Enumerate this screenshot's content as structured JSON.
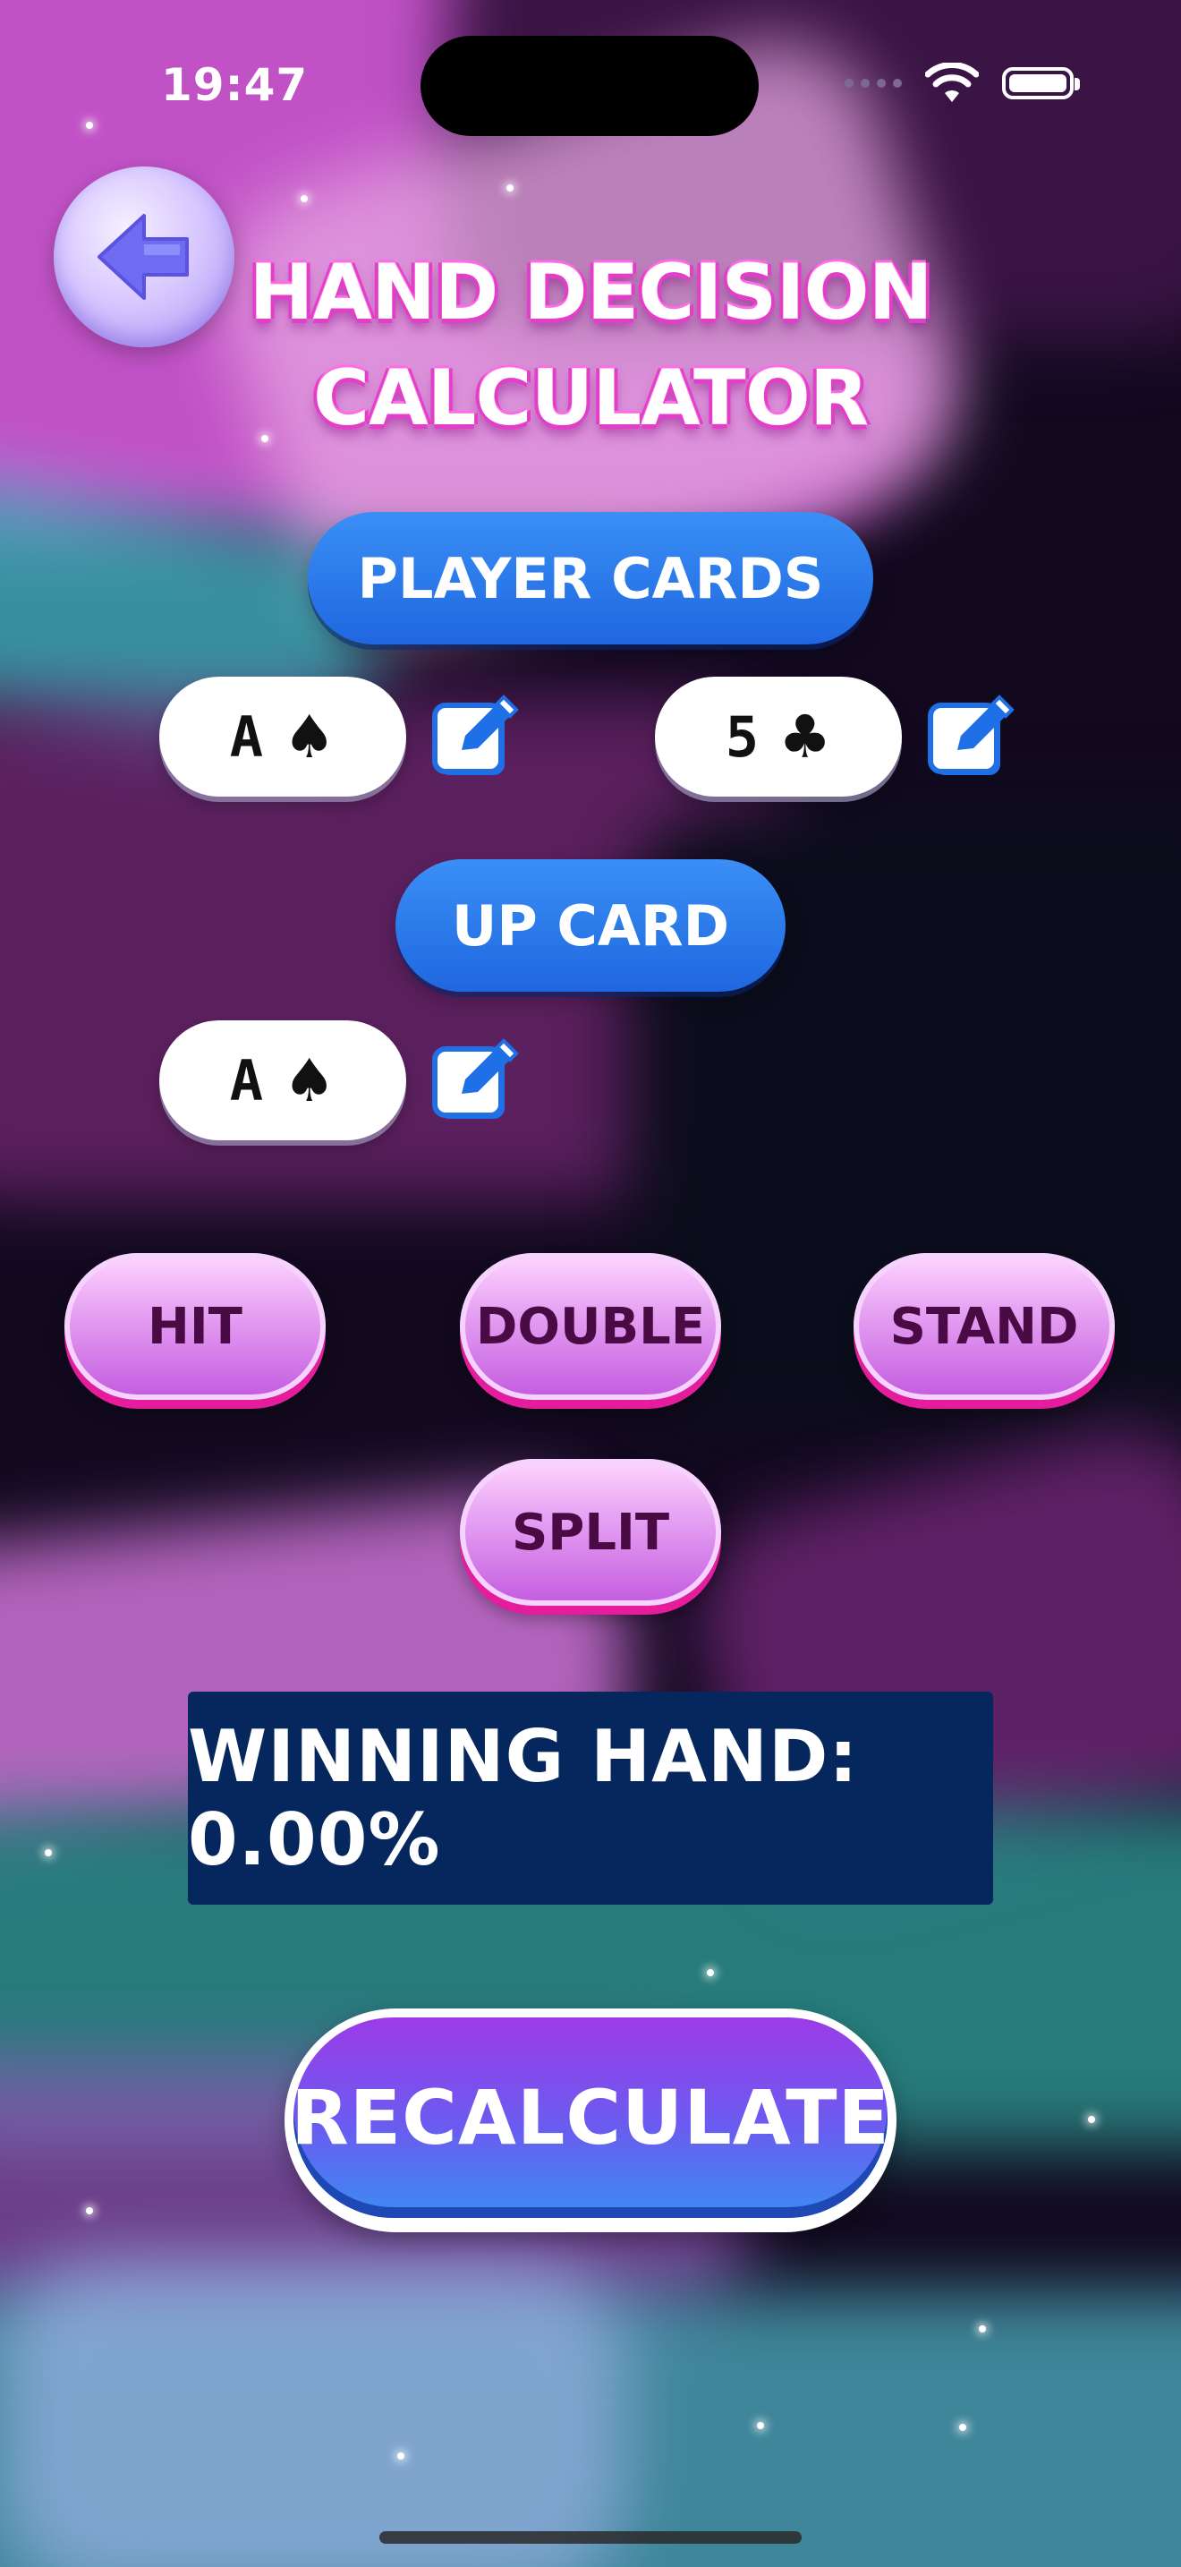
{
  "status_bar": {
    "time": "19:47"
  },
  "header": {
    "title_line1": "HAND DECISION",
    "title_line2": "CALCULATOR"
  },
  "player_section": {
    "label": "PLAYER CARDS",
    "cards": [
      {
        "rank": "A",
        "suit": "♠"
      },
      {
        "rank": "5",
        "suit": "♣"
      }
    ]
  },
  "up_card_section": {
    "label": "UP CARD",
    "card": {
      "rank": "A",
      "suit": "♠"
    }
  },
  "actions": {
    "hit": "HIT",
    "double": "DOUBLE",
    "stand": "STAND",
    "split": "SPLIT"
  },
  "result": {
    "text": "WINNING HAND: 0.00%"
  },
  "recalculate": {
    "label": "RECALCULATE"
  },
  "colors": {
    "label_blue": "#2a7ced",
    "action_pink": "#e51c9c",
    "result_bg": "#06265e",
    "recalc_purple": "#9b3be7"
  }
}
